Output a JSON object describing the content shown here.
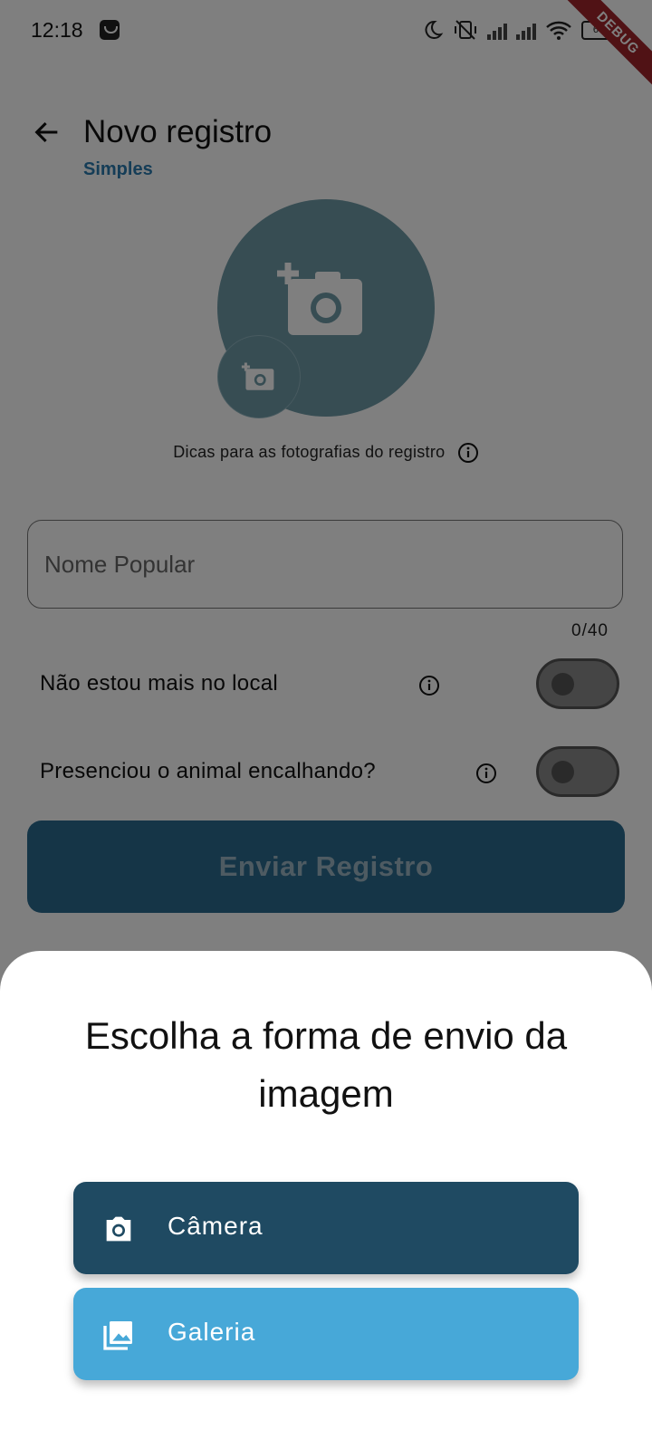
{
  "status_bar": {
    "time": "12:18",
    "battery": "67"
  },
  "debug_banner": "DEBUG",
  "app_bar": {
    "title": "Novo registro",
    "subtitle": "Simples"
  },
  "photo": {
    "tips_text": "Dicas para as fotografias do registro"
  },
  "form": {
    "name_placeholder": "Nome Popular",
    "name_value": "",
    "name_counter": "0/40",
    "toggle_not_on_site": {
      "label": "Não estou mais no local",
      "on": false
    },
    "toggle_stranding": {
      "label": "Presenciou o animal encalhando?",
      "on": false
    },
    "submit_label": "Enviar Registro"
  },
  "sheet": {
    "title": "Escolha a forma de envio da imagem",
    "options": [
      {
        "label": "Câmera",
        "icon": "camera-icon",
        "color": "#1f4a62"
      },
      {
        "label": "Galeria",
        "icon": "gallery-icon",
        "color": "#47a8d8"
      }
    ]
  },
  "colors": {
    "primary_dark": "#1f4a62",
    "primary_light": "#47a8d8",
    "accent_text": "#2a7aae",
    "photo_placeholder": "#6f9aa7"
  }
}
